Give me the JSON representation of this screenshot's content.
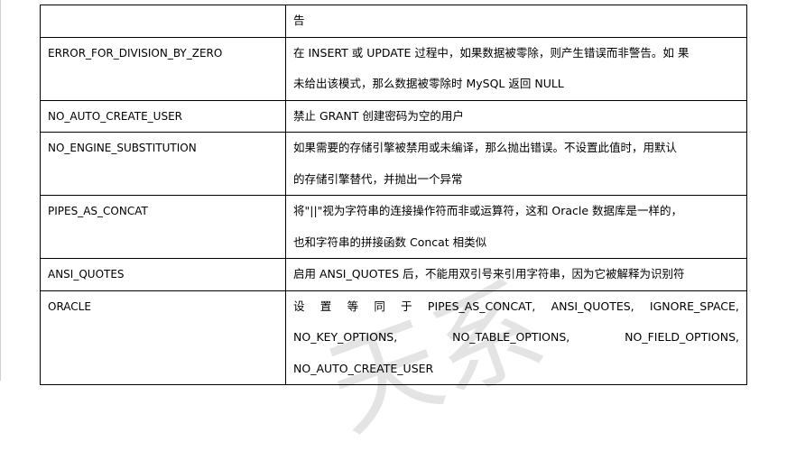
{
  "rows": [
    {
      "name": "",
      "desc_lines": [
        "告"
      ]
    },
    {
      "name": "ERROR_FOR_DIVISION_BY_ZERO",
      "desc_lines": [
        "在 INSERT 或 UPDATE 过程中，如果数据被零除，则产生错误而非警告。如 果",
        "未给出该模式，那么数据被零除时 MySQL 返回 NULL"
      ]
    },
    {
      "name": "NO_AUTO_CREATE_USER",
      "desc_lines": [
        "禁止 GRANT 创建密码为空的用户"
      ]
    },
    {
      "name": "NO_ENGINE_SUBSTITUTION",
      "desc_lines": [
        "如果需要的存储引擎被禁用或未编译，那么抛出错误。不设置此值时，用默认",
        "的存储引擎替代，并抛出一个异常"
      ]
    },
    {
      "name": "PIPES_AS_CONCAT",
      "desc_lines": [
        "将\"||\"视为字符串的连接操作符而非或运算符，这和 Oracle 数据库是一样的，",
        "也和字符串的拼接函数 Concat 相类似"
      ]
    },
    {
      "name": "ANSI_QUOTES",
      "desc_lines": [
        "启用 ANSI_QUOTES 后，不能用双引号来引用字符串，因为它被解释为识别符"
      ]
    },
    {
      "name": "ORACLE",
      "desc_lines": []
    }
  ],
  "oracle_desc": {
    "line1": [
      "设",
      "置",
      "等",
      "同",
      "于",
      "PIPES_AS_CONCAT,",
      "ANSI_QUOTES,",
      "IGNORE_SPACE,"
    ],
    "line2": [
      "NO_KEY_OPTIONS,",
      "NO_TABLE_OPTIONS,",
      "NO_FIELD_OPTIONS,"
    ],
    "line3": "NO_AUTO_CREATE_USER"
  },
  "watermark": "天系"
}
